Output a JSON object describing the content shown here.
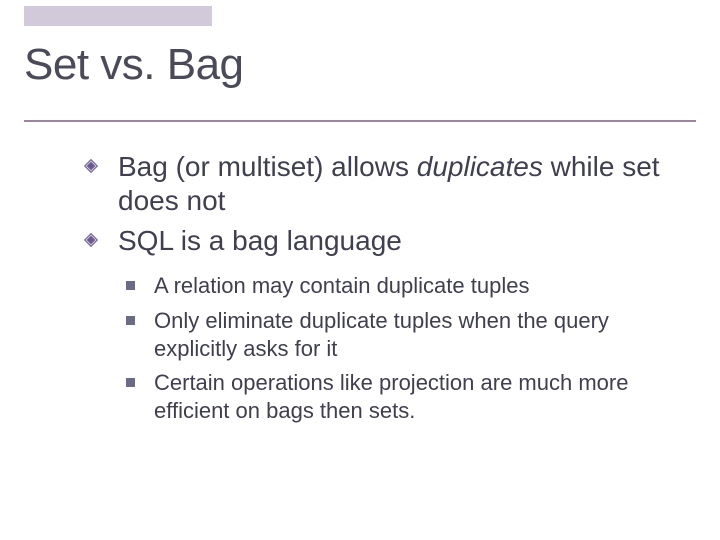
{
  "title": "Set vs. Bag",
  "bullets": {
    "b1_pre": "Bag (or multiset) allows ",
    "b1_em": "duplicates",
    "b1_post": " while set does not",
    "b2": "SQL is a bag language"
  },
  "subs": {
    "s1": "A relation may contain duplicate tuples",
    "s2": "Only eliminate duplicate tuples when the query explicitly asks for it",
    "s3": "Certain operations like projection are much more efficient on bags then sets."
  }
}
